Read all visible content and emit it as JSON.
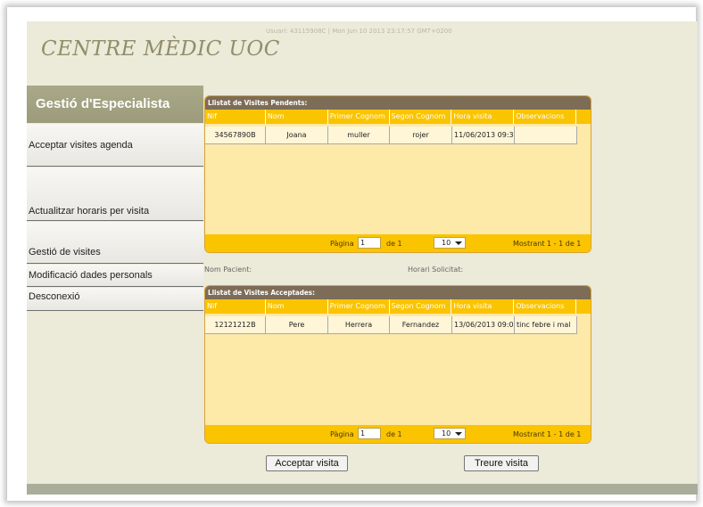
{
  "header": {
    "session_info": "Usuari: 43115908C | Mon Jun 10 2013 23:17:57 GMT+0200",
    "brand": "CENTRE MÈDIC UOC"
  },
  "sidebar": {
    "title": "Gestió d'Especialista",
    "items": [
      {
        "label": "Acceptar visites agenda"
      },
      {
        "label": "Actualitzar horaris per visita"
      },
      {
        "label": "Gestió de visites"
      },
      {
        "label": "Modificació dades personals"
      },
      {
        "label": "Desconexió"
      }
    ]
  },
  "pending": {
    "title": "Llistat de Visites Pendents:",
    "columns": [
      "Nif",
      "Nom",
      "Primer Cognom",
      "Segon Cognom",
      "Hora visita",
      "Observacions"
    ],
    "rows": [
      [
        "34567890B",
        "Joana",
        "muller",
        "rojer",
        "11/06/2013 09:3",
        ""
      ]
    ],
    "footer": {
      "page_label": "Pàgina",
      "page": "1",
      "of_label": "de 1",
      "page_size": "10",
      "summary": "Mostrant 1 - 1 de 1"
    }
  },
  "form": {
    "patient_label": "Nom Pacient:",
    "slot_label": "Horari Solicitat:"
  },
  "accepted": {
    "title": "Llistat de Visites Acceptades:",
    "columns": [
      "Nif",
      "Nom",
      "Primer Cognom",
      "Segon Cognom",
      "Hora visita",
      "Observacions"
    ],
    "rows": [
      [
        "12121212B",
        "Pere",
        "Herrera",
        "Fernandez",
        "13/06/2013 09:0",
        "tinc febre i mal"
      ]
    ],
    "footer": {
      "page_label": "Pàgina",
      "page": "1",
      "of_label": "de 1",
      "page_size": "10",
      "summary": "Mostrant 1 - 1 de 1"
    }
  },
  "actions": {
    "accept": "Acceptar visita",
    "remove": "Treure visita"
  }
}
